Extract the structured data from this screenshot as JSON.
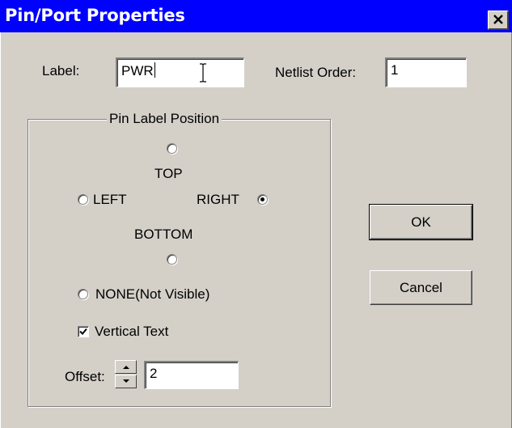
{
  "dialog": {
    "title": "Pin/Port Properties",
    "close_glyph": "×"
  },
  "label_field": {
    "label": "Label:",
    "value": "PWR"
  },
  "netlist_field": {
    "label": "Netlist Order:",
    "value": "1"
  },
  "pin_label_position": {
    "group_title": "Pin Label Position",
    "options": {
      "top": "TOP",
      "left": "LEFT",
      "right": "RIGHT",
      "bottom": "BOTTOM",
      "none": "NONE(Not Visible)"
    },
    "selected": "right"
  },
  "vertical_text": {
    "label": "Vertical Text",
    "checked": true
  },
  "offset": {
    "label": "Offset:",
    "value": "2"
  },
  "buttons": {
    "ok": "OK",
    "cancel": "Cancel"
  },
  "icons": [
    "close-icon",
    "text-cursor-icon",
    "checkmark-icon",
    "spin-up-arrow-icon",
    "spin-down-arrow-icon"
  ]
}
